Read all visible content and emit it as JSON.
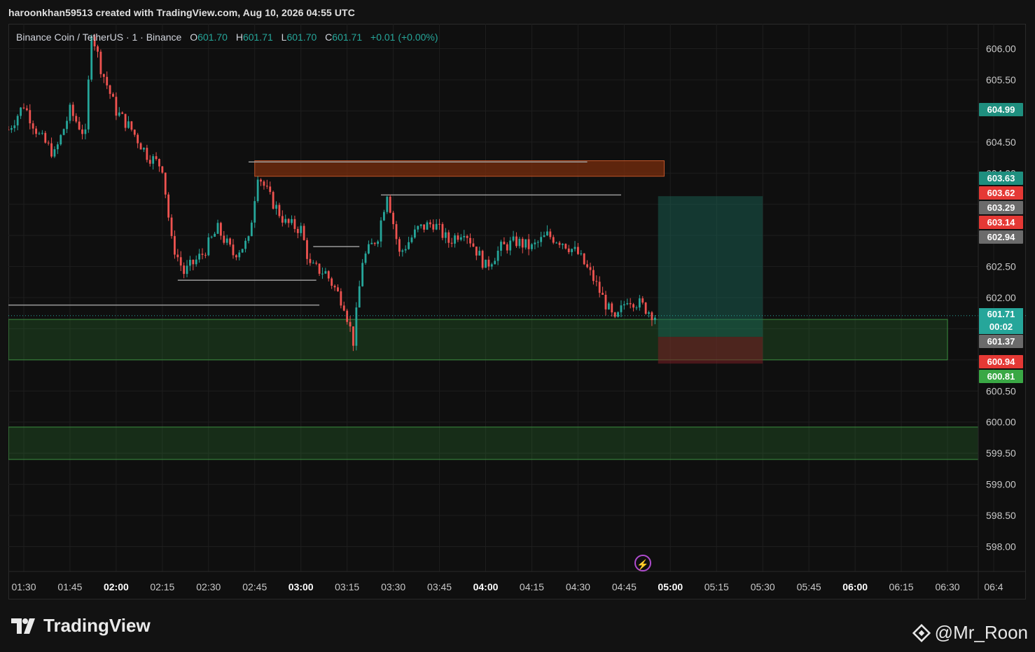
{
  "header": {
    "text": "haroonkhan59513 created with TradingView.com, Aug 10, 2026 04:55 UTC"
  },
  "legend": {
    "symbol": "Binance Coin / TetherUS · 1 · Binance",
    "o_label": "O",
    "o_value": "601.70",
    "h_label": "H",
    "h_value": "601.71",
    "l_label": "L",
    "l_value": "601.70",
    "c_label": "C",
    "c_value": "601.71",
    "change": "+0.01 (+0.00%)"
  },
  "price_axis": {
    "ticks": [
      "606.00",
      "605.50",
      "605.00",
      "604.50",
      "604.00",
      "603.50",
      "603.00",
      "602.50",
      "602.00",
      "601.50",
      "601.00",
      "600.50",
      "600.00",
      "599.50",
      "599.00",
      "598.50",
      "598.00"
    ]
  },
  "price_tags": [
    {
      "value": "604.99",
      "color": "#1f8f7f"
    },
    {
      "value": "603.63",
      "color": "#1f8f7f"
    },
    {
      "value": "603.62",
      "color": "#e53935"
    },
    {
      "value": "603.29",
      "color": "#6b6b6b"
    },
    {
      "value": "603.14",
      "color": "#e53935"
    },
    {
      "value": "602.94",
      "color": "#6b6b6b"
    },
    {
      "value": "601.37",
      "color": "#6b6b6b"
    },
    {
      "value": "600.94",
      "color": "#e53935"
    },
    {
      "value": "600.81",
      "color": "#3aa845"
    }
  ],
  "current_price": {
    "value": "601.71",
    "countdown": "00:02"
  },
  "time_axis": {
    "labels": [
      {
        "t": "01:30",
        "bold": false
      },
      {
        "t": "01:45",
        "bold": false
      },
      {
        "t": "02:00",
        "bold": true
      },
      {
        "t": "02:15",
        "bold": false
      },
      {
        "t": "02:30",
        "bold": false
      },
      {
        "t": "02:45",
        "bold": false
      },
      {
        "t": "03:00",
        "bold": true
      },
      {
        "t": "03:15",
        "bold": false
      },
      {
        "t": "03:30",
        "bold": false
      },
      {
        "t": "03:45",
        "bold": false
      },
      {
        "t": "04:00",
        "bold": true
      },
      {
        "t": "04:15",
        "bold": false
      },
      {
        "t": "04:30",
        "bold": false
      },
      {
        "t": "04:45",
        "bold": false
      },
      {
        "t": "05:00",
        "bold": true
      },
      {
        "t": "05:15",
        "bold": false
      },
      {
        "t": "05:30",
        "bold": false
      },
      {
        "t": "05:45",
        "bold": false
      },
      {
        "t": "06:00",
        "bold": true
      },
      {
        "t": "06:15",
        "bold": false
      },
      {
        "t": "06:30",
        "bold": false
      },
      {
        "t": "06:4",
        "bold": false
      }
    ]
  },
  "footer": {
    "brand": "TradingView",
    "watermark": "@Mr_Roon"
  },
  "colors": {
    "up": "#26a69a",
    "down": "#ef5350",
    "bg": "#0f0f0f",
    "grid": "#1e1e1e"
  },
  "chart_data": {
    "type": "candlestick",
    "title": "Binance Coin / TetherUS · 1 · Binance",
    "ylim": [
      597.6,
      606.4
    ],
    "x_range": [
      "01:25",
      "06:40"
    ],
    "close_path": [
      [
        "01:25",
        604.7
      ],
      [
        "01:30",
        605.1
      ],
      [
        "01:35",
        604.6
      ],
      [
        "01:40",
        604.3
      ],
      [
        "01:45",
        605.0
      ],
      [
        "01:50",
        604.6
      ],
      [
        "01:52",
        606.3
      ],
      [
        "01:55",
        605.7
      ],
      [
        "02:00",
        605.0
      ],
      [
        "02:05",
        604.7
      ],
      [
        "02:10",
        604.3
      ],
      [
        "02:15",
        604.1
      ],
      [
        "02:18",
        602.9
      ],
      [
        "02:22",
        602.4
      ],
      [
        "02:28",
        602.7
      ],
      [
        "02:33",
        603.1
      ],
      [
        "02:38",
        602.7
      ],
      [
        "02:43",
        602.9
      ],
      [
        "02:46",
        604.0
      ],
      [
        "02:50",
        603.6
      ],
      [
        "02:55",
        603.2
      ],
      [
        "03:00",
        603.1
      ],
      [
        "03:03",
        602.5
      ],
      [
        "03:08",
        602.4
      ],
      [
        "03:14",
        601.9
      ],
      [
        "03:17",
        601.3
      ],
      [
        "03:20",
        602.6
      ],
      [
        "03:25",
        603.0
      ],
      [
        "03:28",
        603.7
      ],
      [
        "03:32",
        602.7
      ],
      [
        "03:38",
        603.1
      ],
      [
        "03:43",
        603.2
      ],
      [
        "03:48",
        602.9
      ],
      [
        "03:53",
        603.1
      ],
      [
        "04:00",
        602.5
      ],
      [
        "04:05",
        602.8
      ],
      [
        "04:10",
        602.9
      ],
      [
        "04:15",
        602.8
      ],
      [
        "04:20",
        603.0
      ],
      [
        "04:25",
        602.9
      ],
      [
        "04:30",
        602.7
      ],
      [
        "04:35",
        602.3
      ],
      [
        "04:38",
        602.0
      ],
      [
        "04:42",
        601.6
      ],
      [
        "04:46",
        602.0
      ],
      [
        "04:50",
        601.9
      ],
      [
        "04:55",
        601.71
      ]
    ],
    "zones": [
      {
        "kind": "supply",
        "y": [
          603.95,
          604.2
        ],
        "x": [
          "02:45",
          "04:58"
        ]
      },
      {
        "kind": "demand",
        "y": [
          601.0,
          601.65
        ],
        "x": [
          "01:25",
          "06:30"
        ]
      },
      {
        "kind": "demand",
        "y": [
          599.4,
          599.92
        ],
        "x": [
          "01:25",
          "06:40"
        ]
      },
      {
        "kind": "target",
        "y": [
          601.37,
          603.63
        ],
        "x": [
          "04:56",
          "05:30"
        ]
      },
      {
        "kind": "stop",
        "y": [
          600.94,
          601.37
        ],
        "x": [
          "04:56",
          "05:30"
        ]
      }
    ],
    "levels": [
      {
        "y": 604.18,
        "x": [
          "02:43",
          "04:33"
        ]
      },
      {
        "y": 603.65,
        "x": [
          "03:26",
          "04:44"
        ]
      },
      {
        "y": 602.82,
        "x": [
          "03:04",
          "03:19"
        ]
      },
      {
        "y": 602.28,
        "x": [
          "02:20",
          "03:05"
        ]
      },
      {
        "y": 601.88,
        "x": [
          "01:25",
          "03:06"
        ]
      }
    ]
  }
}
